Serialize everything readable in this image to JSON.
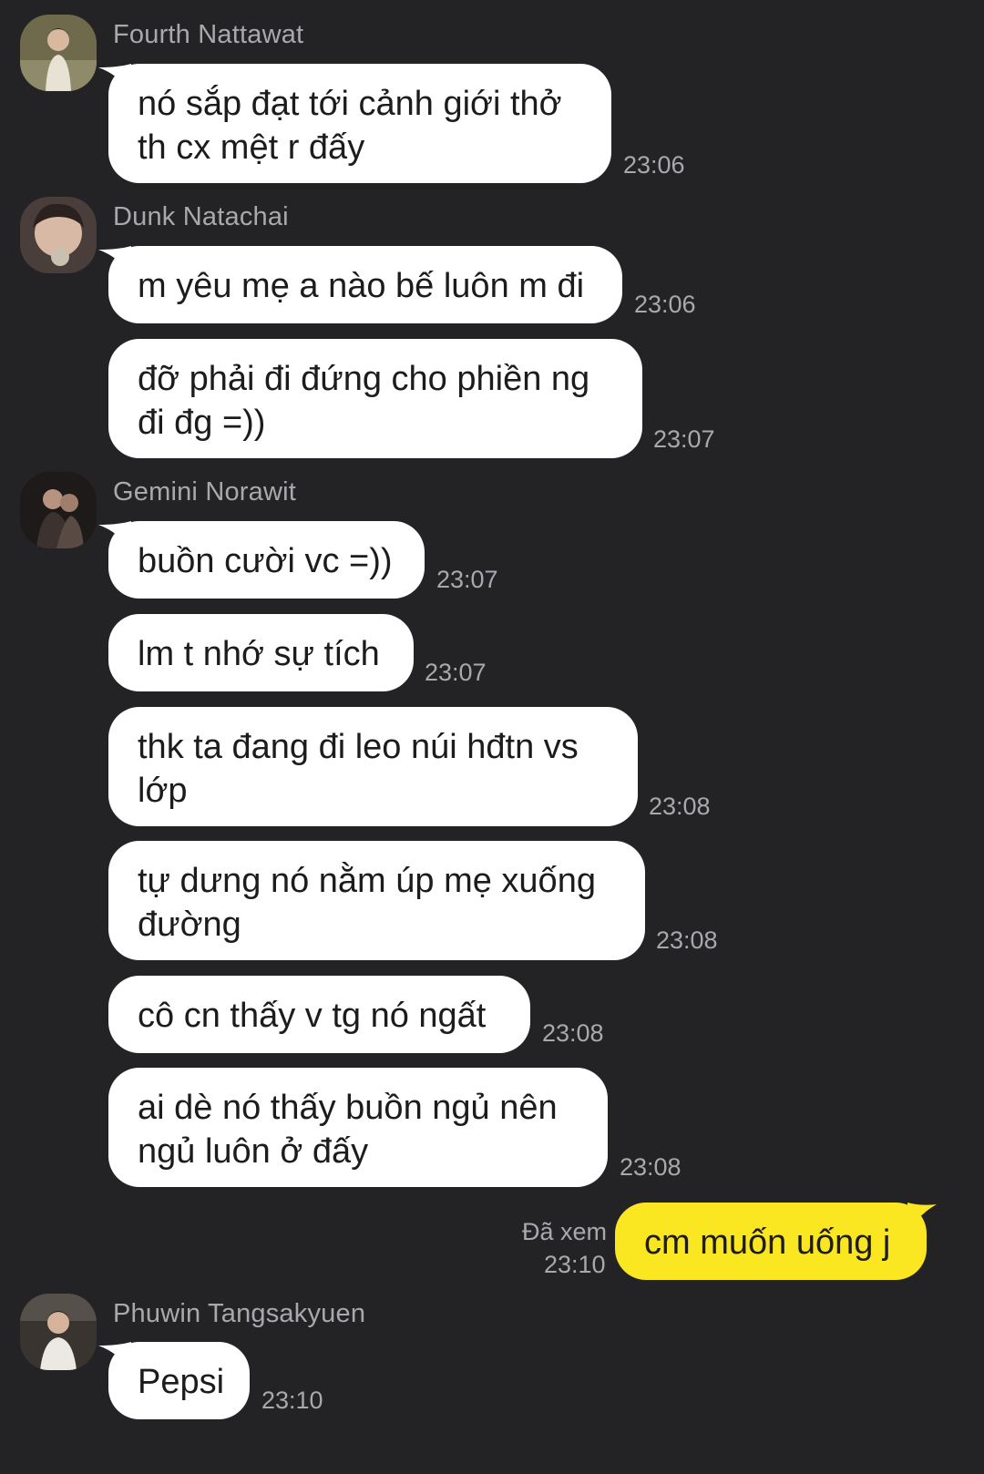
{
  "messages": [
    {
      "sender": "Fourth Nattawat",
      "lines": [
        "nó sắp đạt tới cảnh giới thở",
        "th cx mệt r đấy"
      ],
      "time": "23:06"
    },
    {
      "sender": "Dunk Natachai",
      "lines": [
        "m yêu mẹ a nào bế luôn m đi"
      ],
      "time": "23:06"
    },
    {
      "lines": [
        "đỡ phải đi đứng cho phiền ng",
        "đi đg =))"
      ],
      "time": "23:07"
    },
    {
      "sender": "Gemini Norawit",
      "lines": [
        "buồn cười vc =))"
      ],
      "time": "23:07"
    },
    {
      "lines": [
        "lm t nhớ sự tích"
      ],
      "time": "23:07"
    },
    {
      "lines": [
        "thk ta đang đi leo núi hđtn vs",
        "lớp"
      ],
      "time": "23:08"
    },
    {
      "lines": [
        "tự dưng nó nằm úp mẹ xuống",
        "đường"
      ],
      "time": "23:08"
    },
    {
      "lines": [
        "cô cn thấy v tg nó ngất"
      ],
      "time": "23:08"
    },
    {
      "lines": [
        "ai dè nó thấy buồn ngủ nên",
        "ngủ luôn ở đấy"
      ],
      "time": "23:08"
    },
    {
      "self": true,
      "lines": [
        "cm muốn uống j"
      ],
      "read_status": "Đã xem",
      "time": "23:10"
    },
    {
      "sender": "Phuwin Tangsakyuen",
      "lines": [
        "Pepsi"
      ],
      "time": "23:10"
    }
  ],
  "avatars": [
    {
      "icon": "user-avatar-fourth",
      "color": "#7b6a4a"
    },
    {
      "icon": "user-avatar-dunk",
      "color": "#5a4a42"
    },
    {
      "icon": "user-avatar-gemini",
      "color": "#2e2826"
    },
    {
      "icon": "user-avatar-phuwin",
      "color": "#3a3532"
    }
  ],
  "colors": {
    "background": "#232326",
    "incoming_bubble": "#ffffff",
    "outgoing_bubble": "#fbe622",
    "meta_text": "#a9a9ad"
  }
}
